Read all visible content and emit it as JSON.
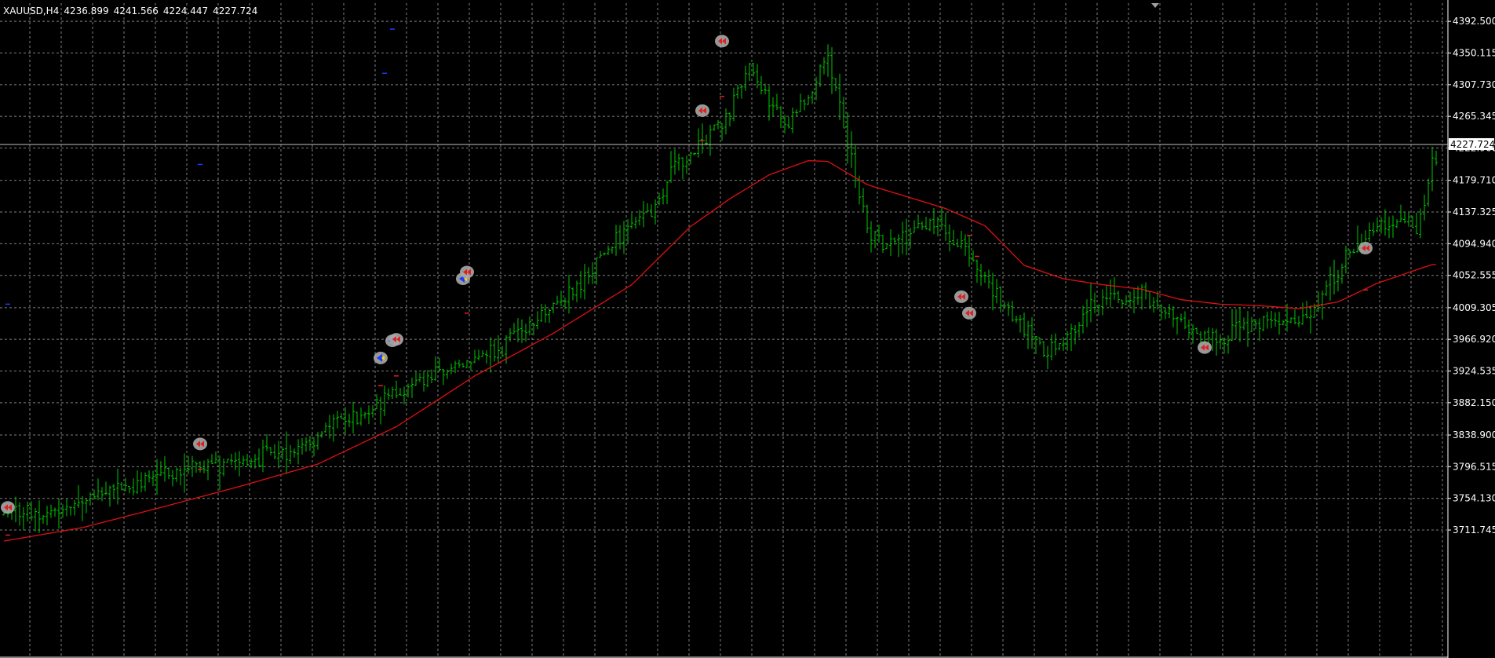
{
  "header": {
    "symbol": "XAUUSD,H4",
    "open": "4236.899",
    "high": "4241.566",
    "low": "4224.447",
    "close": "4227.724"
  },
  "colors": {
    "background": "#000000",
    "grid": "#7f7f7f",
    "bar": "#00c800",
    "ma": "#e01010",
    "axis_text": "#ffffff",
    "price_tag_bg": "#ffffff",
    "marker_ring": "#a8a8a8",
    "buy_arrow": "#1a3cff",
    "sell_arrow": "#e02020"
  },
  "current_price_tag": "4227.724",
  "chart_data": {
    "type": "bar",
    "title": "XAUUSD,H4",
    "xlabel": "",
    "ylabel": "",
    "ylim": [
      3695.0,
      4415.0
    ],
    "grid": true,
    "y_ticks": [
      "4392.500",
      "4350.115",
      "4307.730",
      "4265.345",
      "4222.960",
      "4179.710",
      "4137.325",
      "4094.940",
      "4052.555",
      "4009.305",
      "3966.920",
      "3924.535",
      "3882.150",
      "3838.900",
      "3796.515",
      "3754.130",
      "3711.745"
    ],
    "trend_anchors": [
      [
        0,
        3731
      ],
      [
        10,
        3735
      ],
      [
        20,
        3752
      ],
      [
        30,
        3769
      ],
      [
        40,
        3785
      ],
      [
        50,
        3799
      ],
      [
        60,
        3803
      ],
      [
        70,
        3814
      ],
      [
        80,
        3838
      ],
      [
        90,
        3866
      ],
      [
        100,
        3893
      ],
      [
        112,
        3926
      ],
      [
        118,
        3935
      ],
      [
        125,
        3949
      ],
      [
        132,
        3978
      ],
      [
        140,
        4012
      ],
      [
        148,
        4048
      ],
      [
        155,
        4094
      ],
      [
        160,
        4117
      ],
      [
        165,
        4137
      ],
      [
        172,
        4206
      ],
      [
        178,
        4226
      ],
      [
        185,
        4270
      ],
      [
        190,
        4341
      ],
      [
        195,
        4282
      ],
      [
        200,
        4256
      ],
      [
        205,
        4295
      ],
      [
        210,
        4352
      ],
      [
        215,
        4232
      ],
      [
        220,
        4116
      ],
      [
        225,
        4093
      ],
      [
        230,
        4102
      ],
      [
        235,
        4124
      ],
      [
        240,
        4110
      ],
      [
        245,
        4086
      ],
      [
        250,
        4052
      ],
      [
        255,
        4009
      ],
      [
        260,
        3985
      ],
      [
        265,
        3950
      ],
      [
        270,
        3962
      ],
      [
        275,
        3998
      ],
      [
        280,
        4024
      ],
      [
        285,
        4014
      ],
      [
        290,
        4029
      ],
      [
        295,
        4010
      ],
      [
        300,
        3986
      ],
      [
        305,
        3973
      ],
      [
        310,
        3964
      ],
      [
        315,
        3985
      ],
      [
        320,
        3988
      ],
      [
        325,
        3994
      ],
      [
        330,
        3995
      ],
      [
        335,
        4015
      ],
      [
        340,
        4060
      ],
      [
        345,
        4095
      ],
      [
        350,
        4122
      ],
      [
        355,
        4125
      ],
      [
        360,
        4120
      ],
      [
        362,
        4140
      ],
      [
        364,
        4205
      ]
    ],
    "ma_anchors": [
      [
        0,
        3697
      ],
      [
        20,
        3715
      ],
      [
        40,
        3742
      ],
      [
        60,
        3770
      ],
      [
        80,
        3800
      ],
      [
        100,
        3850
      ],
      [
        120,
        3918
      ],
      [
        140,
        3975
      ],
      [
        160,
        4040
      ],
      [
        175,
        4118
      ],
      [
        185,
        4155
      ],
      [
        195,
        4187
      ],
      [
        205,
        4206
      ],
      [
        210,
        4205
      ],
      [
        220,
        4174
      ],
      [
        230,
        4158
      ],
      [
        240,
        4142
      ],
      [
        250,
        4119
      ],
      [
        260,
        4066
      ],
      [
        270,
        4048
      ],
      [
        280,
        4040
      ],
      [
        290,
        4034
      ],
      [
        300,
        4020
      ],
      [
        310,
        4014
      ],
      [
        320,
        4012
      ],
      [
        330,
        4008
      ],
      [
        340,
        4017
      ],
      [
        350,
        4042
      ],
      [
        360,
        4060
      ],
      [
        364,
        4067
      ]
    ],
    "signals": [
      {
        "type": "sell",
        "bar": 1,
        "price": 3742
      },
      {
        "type": "sell",
        "bar": 50,
        "price": 3827
      },
      {
        "type": "buy",
        "bar": 96,
        "price": 3942
      },
      {
        "type": "buy",
        "bar": 99,
        "price": 3965
      },
      {
        "type": "sell",
        "bar": 100,
        "price": 3967
      },
      {
        "type": "buy",
        "bar": 117,
        "price": 4048
      },
      {
        "type": "sell",
        "bar": 118,
        "price": 4057
      },
      {
        "type": "sell",
        "bar": 178,
        "price": 4273
      },
      {
        "type": "sell",
        "bar": 183,
        "price": 4366
      },
      {
        "type": "sell",
        "bar": 244,
        "price": 4024
      },
      {
        "type": "sell",
        "bar": 246,
        "price": 4002
      },
      {
        "type": "sell",
        "bar": 306,
        "price": 3956
      },
      {
        "type": "sell",
        "bar": 347,
        "price": 4089
      }
    ],
    "stubs": [
      {
        "color": "blue",
        "bar": 99,
        "price": 4382
      },
      {
        "color": "blue",
        "bar": 97,
        "price": 4323
      },
      {
        "color": "blue",
        "bar": 50,
        "price": 4201
      },
      {
        "color": "blue",
        "bar": 1,
        "price": 4014
      },
      {
        "color": "red",
        "bar": 1,
        "price": 3705
      },
      {
        "color": "red",
        "bar": 50,
        "price": 3793
      },
      {
        "color": "red",
        "bar": 96,
        "price": 3905
      },
      {
        "color": "red",
        "bar": 100,
        "price": 3918
      },
      {
        "color": "red",
        "bar": 118,
        "price": 4002
      },
      {
        "color": "red",
        "bar": 178,
        "price": 4233
      },
      {
        "color": "red",
        "bar": 183,
        "price": 4292
      },
      {
        "color": "red",
        "bar": 246,
        "price": 4106
      },
      {
        "color": "red",
        "bar": 248,
        "price": 4078
      },
      {
        "color": "red",
        "bar": 347,
        "price": 4033
      }
    ]
  }
}
